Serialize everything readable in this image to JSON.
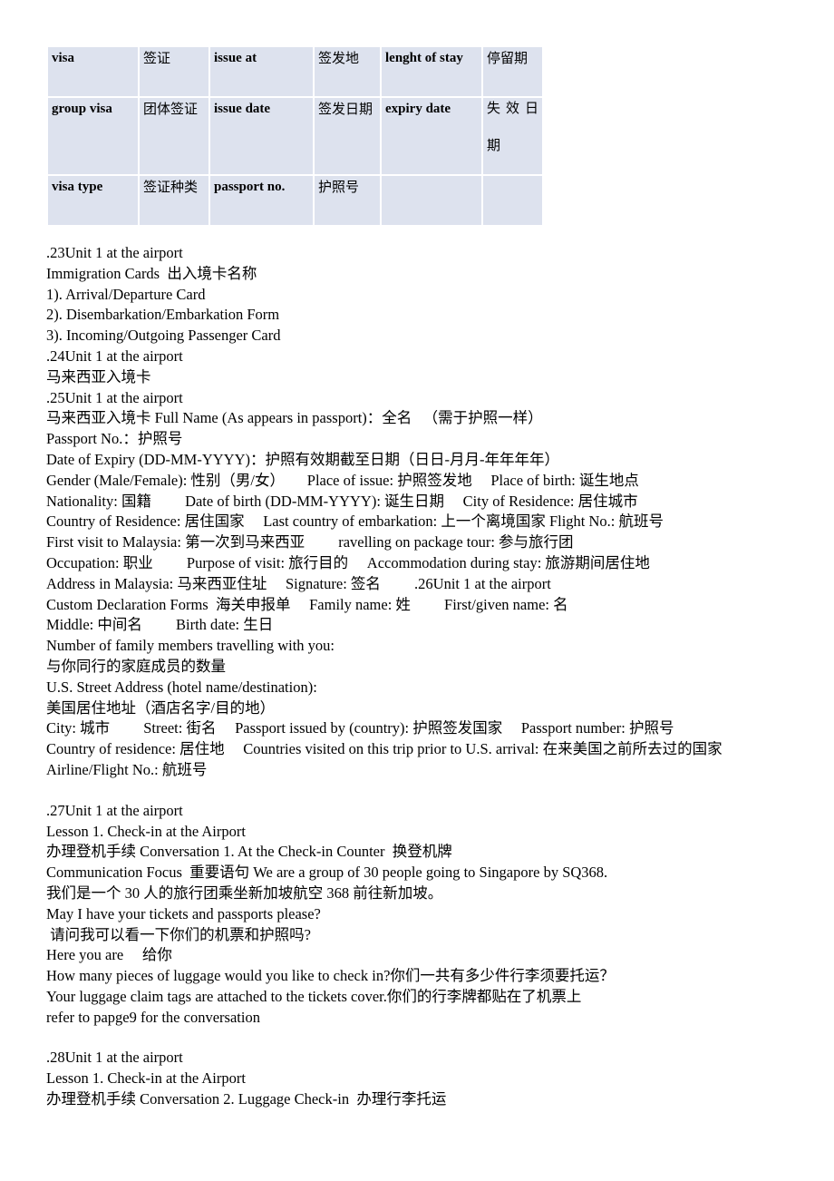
{
  "document": {
    "title": "Unit 1 at the airport"
  },
  "visa_table": {
    "name": "visa-terms-table",
    "columns": 6,
    "rows": [
      {
        "cells": [
          {
            "text": "visa",
            "lang": "en"
          },
          {
            "text": "签证",
            "lang": "zh"
          },
          {
            "text": "issue at",
            "lang": "en"
          },
          {
            "text": "签发地",
            "lang": "zh"
          },
          {
            "text": "lenght of stay",
            "lang": "en"
          },
          {
            "text": "停留期",
            "lang": "zh"
          }
        ]
      },
      {
        "cells": [
          {
            "text": "group visa",
            "lang": "en"
          },
          {
            "text": "团体签证",
            "lang": "zh"
          },
          {
            "text": "issue date",
            "lang": "en"
          },
          {
            "text": "签发日期",
            "lang": "zh"
          },
          {
            "text": "expiry date",
            "lang": "en"
          },
          {
            "text": "失 效 日",
            "text2": "期",
            "lang": "zh-justify"
          }
        ]
      },
      {
        "cells": [
          {
            "text": "visa type",
            "lang": "en"
          },
          {
            "text": "签证种类",
            "lang": "zh"
          },
          {
            "text": "passport no.",
            "lang": "en"
          },
          {
            "text": "护照号",
            "lang": "zh"
          },
          {
            "text": "",
            "lang": "en"
          },
          {
            "text": "",
            "lang": "zh"
          }
        ]
      }
    ]
  },
  "content_blocks": [
    {
      "id": "slide-23-26",
      "lines": [
        ".23Unit 1 at the airport",
        "Immigration Cards  出入境卡名称",
        "1). Arrival/Departure Card",
        "2). Disembarkation/Embarkation Form",
        "3). Incoming/Outgoing Passenger Card",
        ".24Unit 1 at the airport",
        "马来西亚入境卡",
        ".25Unit 1 at the airport",
        "马来西亚入境卡 Full Name (As appears in passport)：全名 　（需于护照一样）",
        "Passport No.：护照号",
        "Date of Expiry (DD-MM-YYYY)：护照有效期截至日期（日日-月月-年年年年）",
        "Gender (Male/Female): 性别（男/女）　　Place of issue: 护照签发地　 Place of birth: 诞生地点",
        "Nationality: 国籍　　 Date of birth (DD-MM-YYYY): 诞生日期　 City of Residence: 居住城市",
        "Country of Residence: 居住国家　 Last country of embarkation: 上一个离境国家 Flight No.: 航班号",
        "First visit to Malaysia: 第一次到马来西亚　　 ravelling on package tour: 参与旅行团",
        "Occupation: 职业　　 Purpose of visit: 旅行目的　 Accommodation during stay: 旅游期间居住地",
        "Address in Malaysia: 马来西亚住址　 Signature: 签名　　 .26Unit 1 at the airport",
        "Custom Declaration Forms  海关申报单　 Family name: 姓　　 First/given name: 名",
        "Middle: 中间名　　 Birth date: 生日",
        "Number of family members travelling with you:",
        "与你同行的家庭成员的数量",
        "U.S. Street Address (hotel name/destination):",
        "美国居住地址（酒店名字/目的地）",
        "City: 城市　　 Street: 街名　 Passport issued by (country): 护照签发国家　 Passport number: 护照号",
        "Country of residence: 居住地　 Countries visited on this trip prior to U.S. arrival: 在来美国之前所去过的国家",
        "Airline/Flight No.: 航班号"
      ]
    },
    {
      "id": "slide-27",
      "lines": [
        ".27Unit 1 at the airport",
        "Lesson 1. Check-in at the Airport",
        "办理登机手续 Conversation 1. At the Check-in Counter  换登机牌",
        "Communication Focus  重要语句 We are a group of 30 people going to Singapore by SQ368.",
        "我们是一个 30 人的旅行团乘坐新加坡航空 368 前往新加坡。",
        "May I have your tickets and passports please?",
        " 请问我可以看一下你们的机票和护照吗?",
        "Here you are　 给你",
        "How many pieces of luggage would you like to check in?你们一共有多少件行李须要托运？",
        "Your luggage claim tags are attached to the tickets cover.你们的行李牌都贴在了机票上",
        "refer to papge9 for the conversation"
      ]
    },
    {
      "id": "slide-28",
      "lines": [
        ".28Unit 1 at the airport",
        "Lesson 1. Check-in at the Airport",
        "办理登机手续 Conversation 2. Luggage Check-in  办理行李托运"
      ]
    }
  ],
  "colors": {
    "cell_background": "#dde2ee",
    "page_background": "#ffffff",
    "text": "#000000"
  }
}
